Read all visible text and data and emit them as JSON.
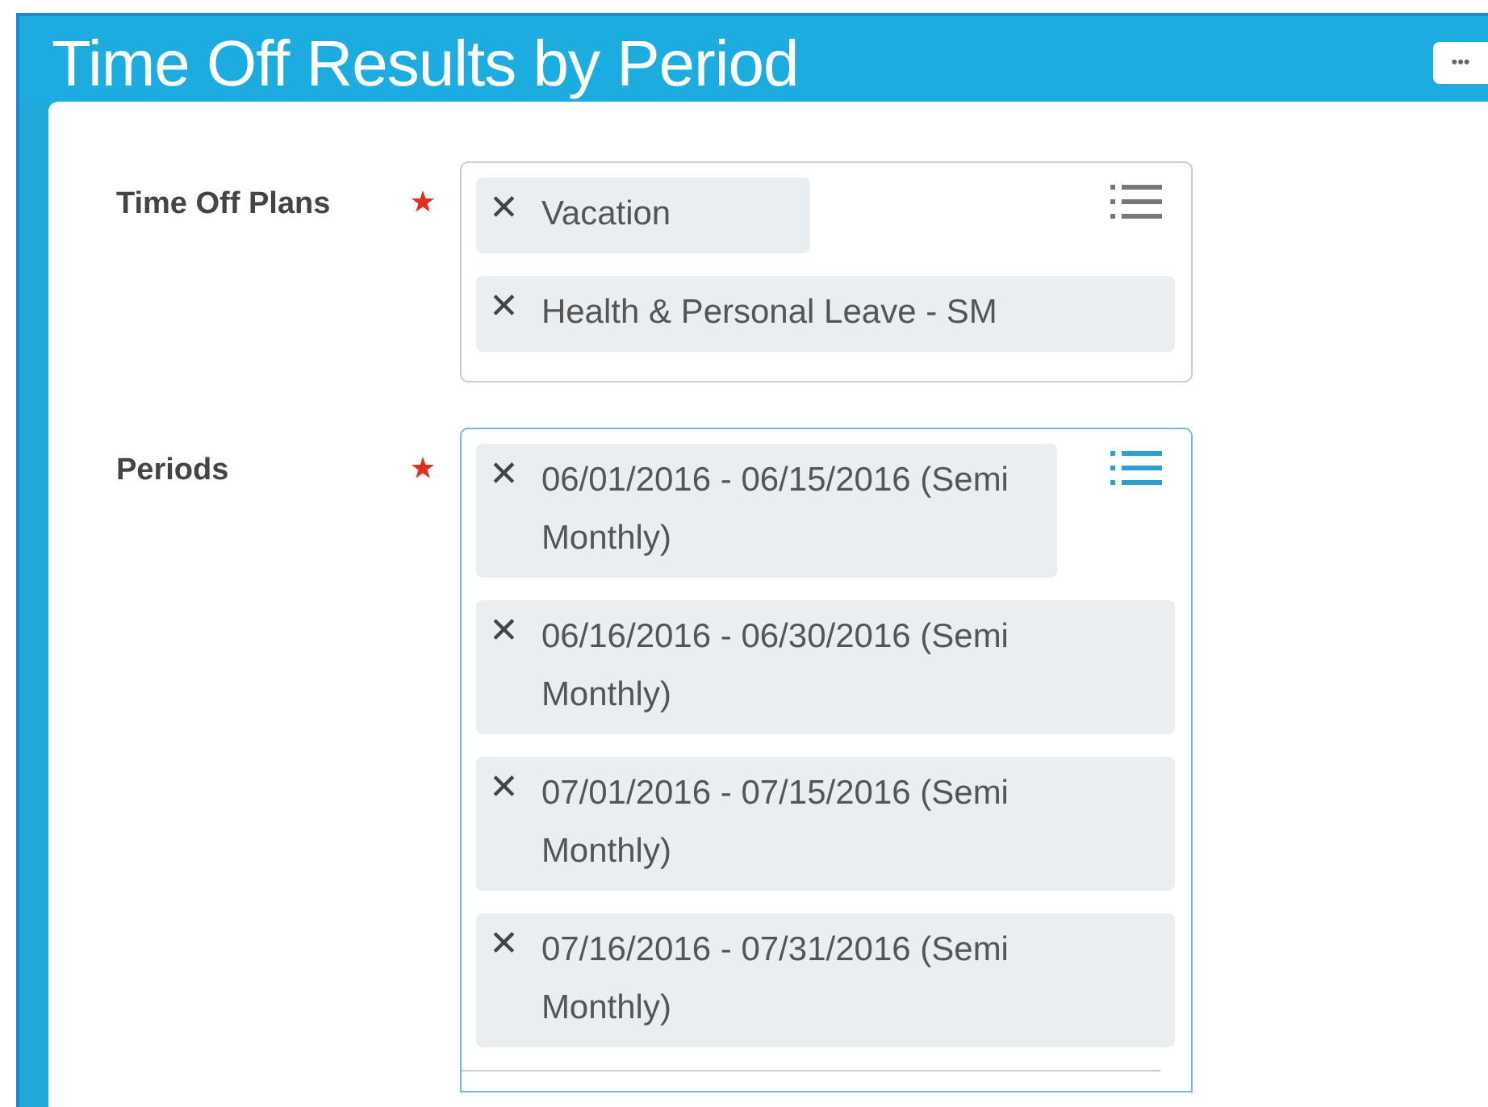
{
  "header": {
    "title": "Time Off Results by Period",
    "more_button": "•••"
  },
  "fields": [
    {
      "label": "Time Off Plans",
      "required": true,
      "focused": false,
      "chips": [
        {
          "remove": "✕",
          "text": "Vacation"
        },
        {
          "remove": "✕",
          "text": "Health & Personal Leave - SM"
        }
      ]
    },
    {
      "label": "Periods",
      "required": true,
      "focused": true,
      "chips": [
        {
          "remove": "✕",
          "text": "06/01/2016 - 06/15/2016 (Semi Monthly)"
        },
        {
          "remove": "✕",
          "text": "06/16/2016 - 06/30/2016 (Semi Monthly)"
        },
        {
          "remove": "✕",
          "text": "07/01/2016 - 07/15/2016 (Semi Monthly)"
        },
        {
          "remove": "✕",
          "text": "07/16/2016 - 07/31/2016 (Semi Monthly)"
        }
      ]
    }
  ]
}
